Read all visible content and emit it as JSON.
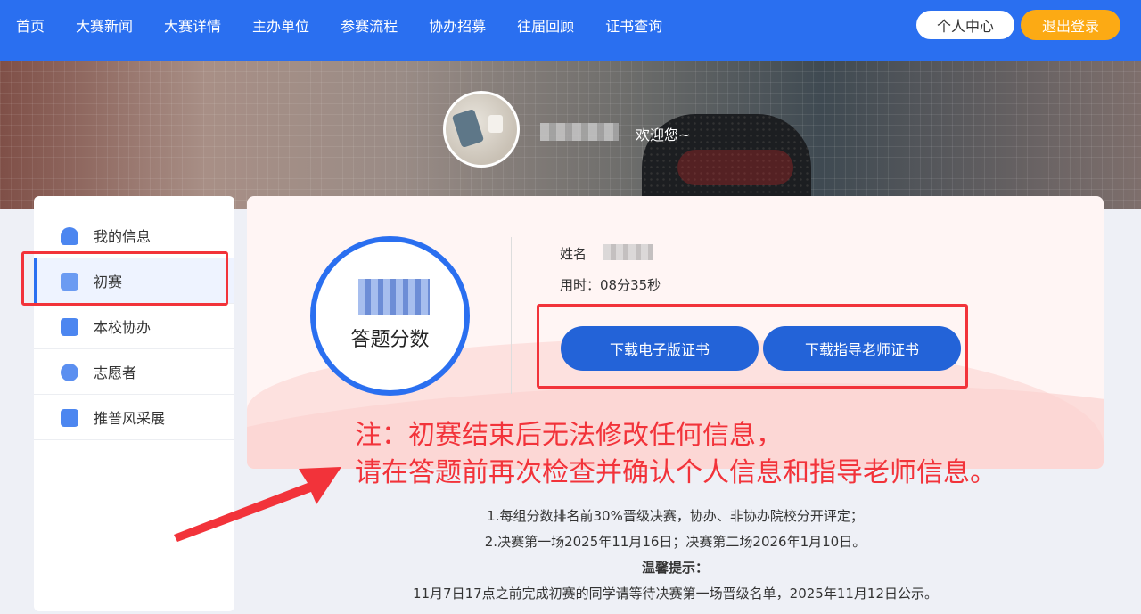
{
  "nav": {
    "items": [
      "首页",
      "大赛新闻",
      "大赛详情",
      "主办单位",
      "参赛流程",
      "协办招募",
      "往届回顾",
      "证书查询"
    ],
    "personal_center": "个人中心",
    "logout": "退出登录"
  },
  "profile": {
    "welcome": "欢迎您~"
  },
  "sidebar": {
    "items": [
      {
        "label": "我的信息",
        "icon": "user-icon"
      },
      {
        "label": "初赛",
        "icon": "document-icon"
      },
      {
        "label": "本校协办",
        "icon": "school-icon"
      },
      {
        "label": "志愿者",
        "icon": "medal-icon"
      },
      {
        "label": "推普风采展",
        "icon": "gallery-icon"
      }
    ],
    "active_index": 1
  },
  "result": {
    "score_label": "答题分数",
    "name_label": "姓名",
    "time_line": "用时：08分35秒",
    "download_cert": "下载电子版证书",
    "download_teacher_cert": "下载指导老师证书"
  },
  "note": {
    "line1": "注：初赛结束后无法修改任何信息，",
    "line2": "请在答题前再次检查并确认个人信息和指导老师信息。"
  },
  "rules": {
    "rule1": "1.每组分数排名前30%晋级决赛，协办、非协办院校分开评定；",
    "rule2": "2.决赛第一场2025年11月16日；决赛第二场2026年1月10日。",
    "tip_title": "温馨提示：",
    "tip_text": "11月7日17点之前完成初赛的同学请等待决赛第一场晋级名单，2025年11月12日公示。"
  },
  "colors": {
    "primary": "#2a6ff0",
    "button": "#2363d8",
    "logout": "#fcaa14",
    "annotation_red": "#f2333a"
  }
}
